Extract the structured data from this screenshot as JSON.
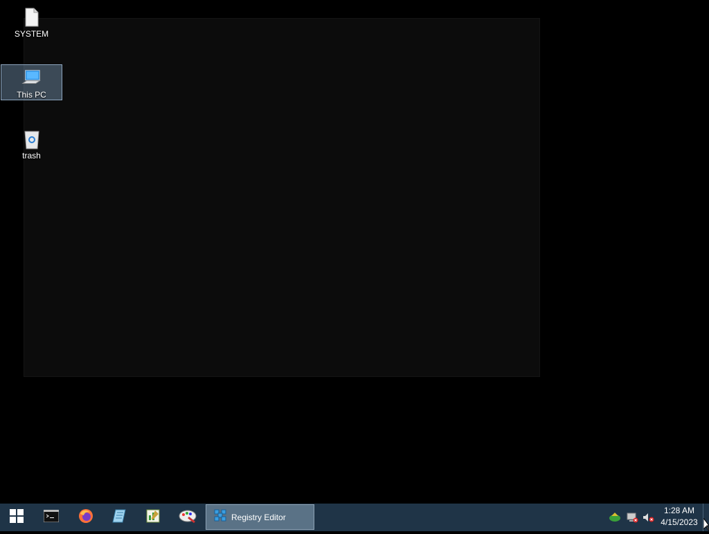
{
  "desktop": {
    "icons": [
      {
        "label": "SYSTEM",
        "icon": "file-icon",
        "selected": false
      },
      {
        "label": "This PC",
        "icon": "computer-icon",
        "selected": true
      },
      {
        "label": "trash",
        "icon": "recycle-bin-icon",
        "selected": false
      }
    ]
  },
  "taskbar": {
    "pinned": [
      "start-icon",
      "command-prompt-icon",
      "firefox-icon",
      "notepad-icon",
      "spreadsheet-editor-icon",
      "paint-icon"
    ],
    "active_app": {
      "label": "Registry Editor",
      "icon": "registry-editor-icon"
    },
    "tray": [
      "network-sync-icon",
      "network-disconnected-icon",
      "volume-muted-icon"
    ],
    "clock": {
      "time": "1:28 AM",
      "date": "4/15/2023"
    }
  }
}
